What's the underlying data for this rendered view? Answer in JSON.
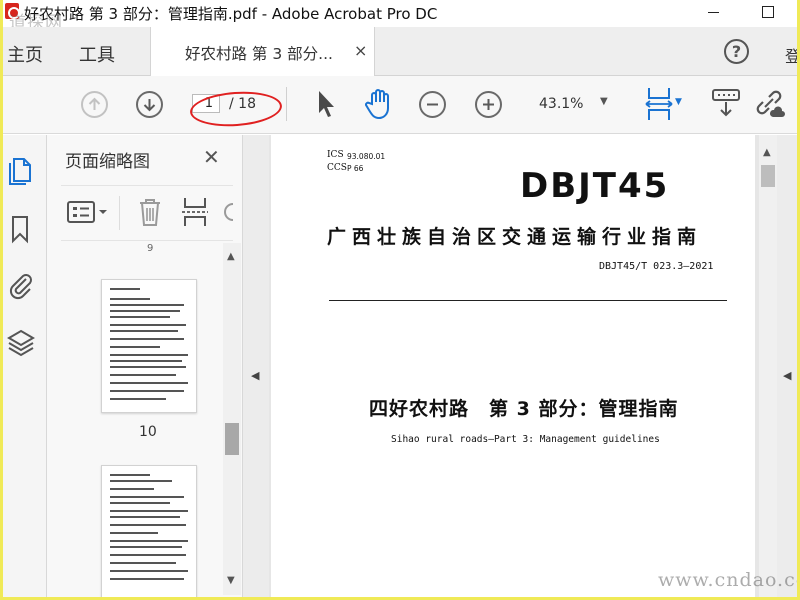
{
  "window": {
    "title": "好农村路 第 3 部分：管理指南.pdf - Adobe Acrobat Pro DC",
    "watermark_top": "道探网",
    "watermark_bottom": "www.cndao.com"
  },
  "tabs": {
    "home": "主页",
    "tools": "工具",
    "document_tab": "好农村路 第 3 部分...",
    "close_glyph": "×",
    "help": "?",
    "signin": "登"
  },
  "toolbar": {
    "current_page": "1",
    "page_total": "/ 18",
    "zoom": "43.1%",
    "zoom_caret": "▼",
    "fit_caret": "▼"
  },
  "thumbnails": {
    "title": "页面缩略图",
    "close_glyph": "✕",
    "above_label": "9",
    "page_labels": [
      "10"
    ]
  },
  "document": {
    "ics_label": "ICS",
    "ics_value": "93.080.01",
    "ccs_label": "CCS",
    "ccs_value": "P 66",
    "logo": "DBJT45",
    "issuer": "广西壮族自治区交通运输行业指南",
    "code": "DBJT45/T 023.3—2021",
    "title_cn": "四好农村路　第 3 部分：管理指南",
    "title_en": "Sihao rural roads—Part 3: Management guidelines"
  },
  "colors": {
    "border_highlight": "#f0ea57",
    "annotation_red": "#e02020",
    "accent_blue": "#1a73d2"
  }
}
